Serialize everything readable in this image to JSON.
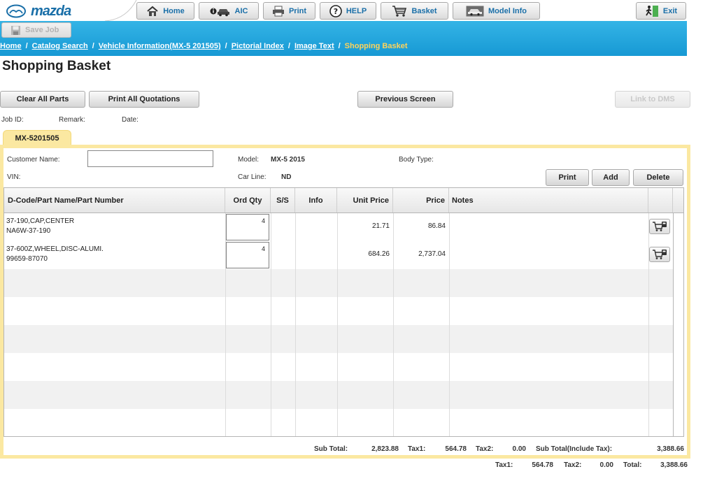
{
  "brand": {
    "name": "mazda"
  },
  "nav": {
    "home": "Home",
    "aic": "AIC",
    "print": "Print",
    "help": "HELP",
    "basket": "Basket",
    "model_info": "Model Info",
    "exit": "Exit"
  },
  "toolbar": {
    "save_job": "Save Job"
  },
  "breadcrumb": {
    "items": [
      "Home",
      "Catalog Search",
      "Vehicle Information(MX-5 201505)",
      "Pictorial Index",
      "Image Text"
    ],
    "current": "Shopping Basket",
    "separator": "/"
  },
  "page": {
    "title": "Shopping Basket"
  },
  "actions": {
    "clear_all": "Clear All Parts",
    "print_all": "Print All Quotations",
    "previous": "Previous Screen",
    "link_dms": "Link to DMS"
  },
  "job": {
    "job_id_label": "Job ID:",
    "remark_label": "Remark:",
    "date_label": "Date:"
  },
  "tab": {
    "label": "MX-5201505"
  },
  "vehicle": {
    "customer_label": "Customer Name:",
    "customer_value": "",
    "vin_label": "VIN:",
    "model_label": "Model:",
    "model_value": "MX-5 2015",
    "carline_label": "Car Line:",
    "carline_value": "ND",
    "bodytype_label": "Body Type:"
  },
  "grid_actions": {
    "print": "Print",
    "add": "Add",
    "delete": "Delete"
  },
  "table": {
    "columns": [
      "D-Code/Part Name/Part Number",
      "Ord Qty",
      "S/S",
      "Info",
      "Unit Price",
      "Price",
      "Notes"
    ],
    "rows": [
      {
        "name": "37-190,CAP,CENTER",
        "number": "NA6W-37-190",
        "qty": "4",
        "unit_price": "21.71",
        "price": "86.84"
      },
      {
        "name": "37-600Z,WHEEL,DISC-ALUMI.",
        "number": "99659-87070",
        "qty": "4",
        "unit_price": "684.26",
        "price": "2,737.04"
      }
    ]
  },
  "totals": {
    "subtotal_label": "Sub Total:",
    "subtotal": "2,823.88",
    "tax1_label": "Tax1:",
    "tax1": "564.78",
    "tax2_label": "Tax2:",
    "tax2": "0.00",
    "subtotal_tax_label": "Sub Total(Include Tax):",
    "subtotal_tax": "3,388.66"
  },
  "grand": {
    "tax1_label": "Tax1:",
    "tax1": "564.78",
    "tax2_label": "Tax2:",
    "tax2": "0.00",
    "total_label": "Total:",
    "total": "3,388.66"
  },
  "colors": {
    "accent": "#1799d4",
    "link_current": "#ffd35a",
    "tab": "#fbe8a1",
    "brand": "#1a6fa8"
  }
}
